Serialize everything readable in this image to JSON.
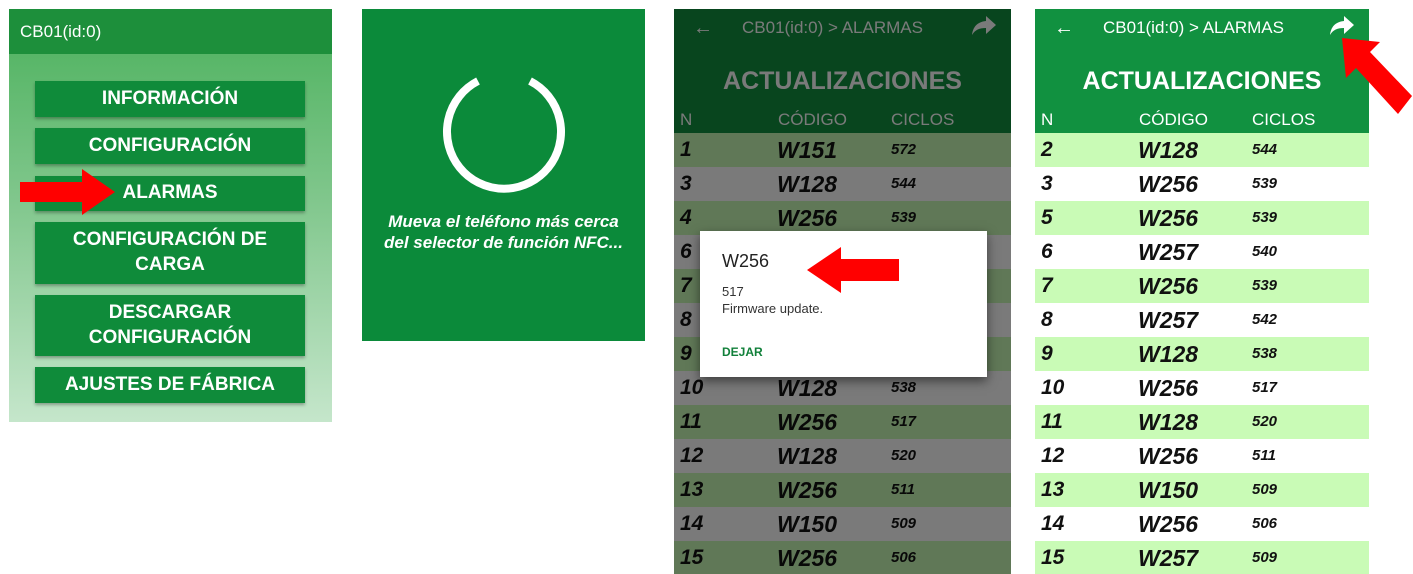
{
  "menu": {
    "title": "CB01(id:0)",
    "items": [
      "INFORMACIÓN",
      "CONFIGURACIÓN",
      "ALARMAS",
      "CONFIGURACIÓN DE CARGA",
      "DESCARGAR CONFIGURACIÓN",
      "AJUSTES DE FÁBRICA"
    ]
  },
  "nfc": {
    "message_line1": "Mueva el teléfono más cerca",
    "message_line2": "del selector de función NFC..."
  },
  "alarms": {
    "title": "CB01(id:0) > ALARMAS",
    "heading": "ACTUALIZACIONES",
    "col_n": "N",
    "col_code": "CÓDIGO",
    "col_cycles": "CICLOS"
  },
  "table3_rows": [
    {
      "n": "1",
      "code": "W151",
      "cycles": "572"
    },
    {
      "n": "3",
      "code": "W128",
      "cycles": "544"
    },
    {
      "n": "4",
      "code": "W256",
      "cycles": "539"
    },
    {
      "n": "6",
      "code": "",
      "cycles": ""
    },
    {
      "n": "7",
      "code": "",
      "cycles": ""
    },
    {
      "n": "8",
      "code": "",
      "cycles": ""
    },
    {
      "n": "9",
      "code": "",
      "cycles": ""
    },
    {
      "n": "10",
      "code": "W128",
      "cycles": "538"
    },
    {
      "n": "11",
      "code": "W256",
      "cycles": "517"
    },
    {
      "n": "12",
      "code": "W128",
      "cycles": "520"
    },
    {
      "n": "13",
      "code": "W256",
      "cycles": "511"
    },
    {
      "n": "14",
      "code": "W150",
      "cycles": "509"
    },
    {
      "n": "15",
      "code": "W256",
      "cycles": "506"
    }
  ],
  "dialog": {
    "title": "W256",
    "line1": "517",
    "line2": "Firmware update.",
    "button": "DEJAR"
  },
  "table4_rows": [
    {
      "n": "2",
      "code": "W128",
      "cycles": "544"
    },
    {
      "n": "3",
      "code": "W256",
      "cycles": "539"
    },
    {
      "n": "5",
      "code": "W256",
      "cycles": "539"
    },
    {
      "n": "6",
      "code": "W257",
      "cycles": "540"
    },
    {
      "n": "7",
      "code": "W256",
      "cycles": "539"
    },
    {
      "n": "8",
      "code": "W257",
      "cycles": "542"
    },
    {
      "n": "9",
      "code": "W128",
      "cycles": "538"
    },
    {
      "n": "10",
      "code": "W256",
      "cycles": "517"
    },
    {
      "n": "11",
      "code": "W128",
      "cycles": "520"
    },
    {
      "n": "12",
      "code": "W256",
      "cycles": "511"
    },
    {
      "n": "13",
      "code": "W150",
      "cycles": "509"
    },
    {
      "n": "14",
      "code": "W256",
      "cycles": "506"
    },
    {
      "n": "15",
      "code": "W257",
      "cycles": "509"
    }
  ],
  "colors": {
    "green_dark": "#119140",
    "row_light_green": "#c9fbb6",
    "row_white": "#ffffff",
    "arrow_red": "#ff0000"
  },
  "icons": [
    "back-arrow-icon",
    "share-forward-icon",
    "loading-spinner-icon",
    "red-pointer-arrow-icon"
  ]
}
